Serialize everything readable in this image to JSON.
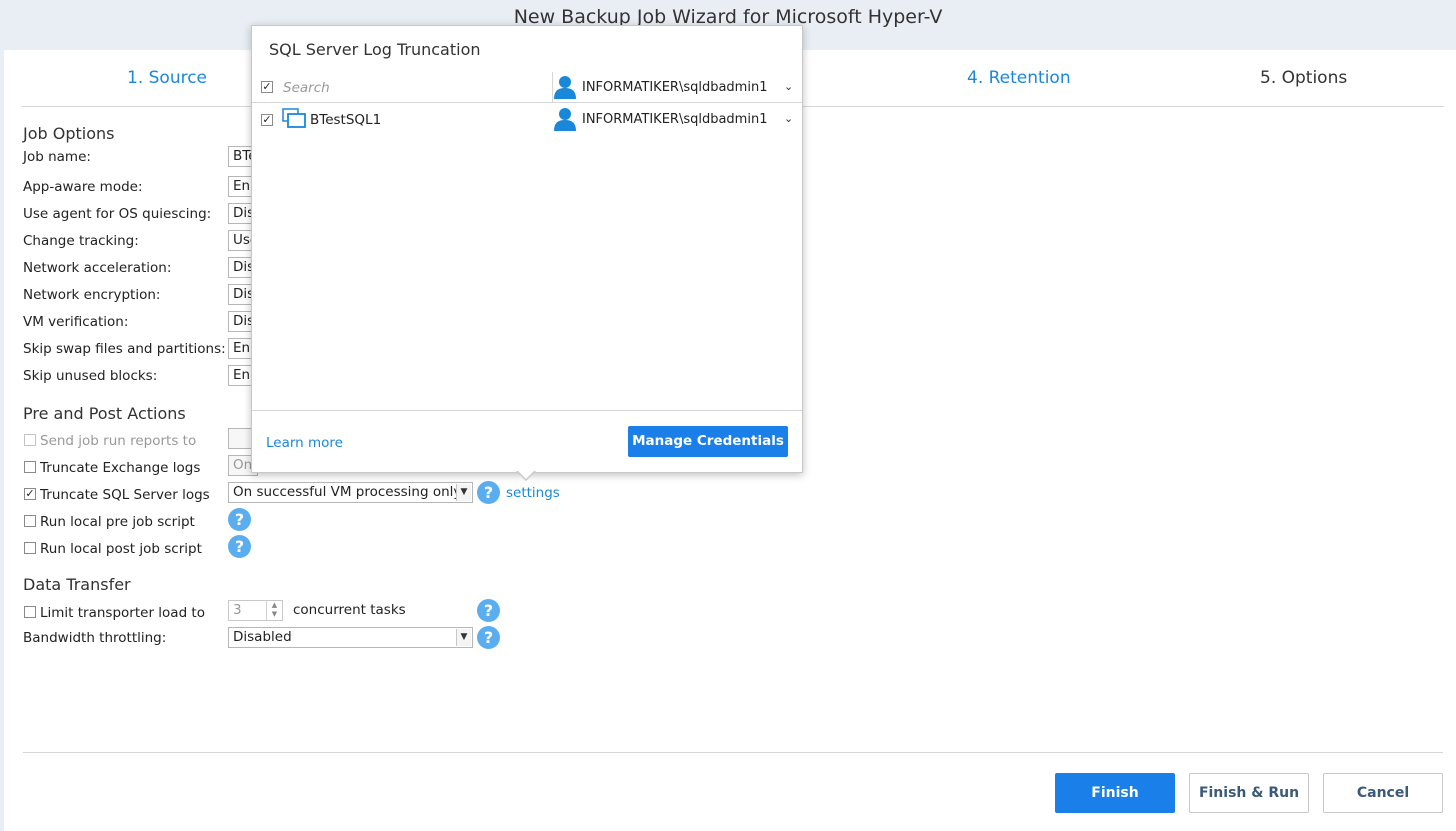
{
  "window": {
    "title": "New Backup Job Wizard for Microsoft Hyper-V"
  },
  "steps": [
    {
      "label": "1. Source",
      "state": "link"
    },
    {
      "label": "4. Retention",
      "state": "link"
    },
    {
      "label": "5. Options",
      "state": "active"
    }
  ],
  "job_options": {
    "title": "Job Options",
    "rows": [
      {
        "label": "Job name:",
        "value": "BTe"
      },
      {
        "label": "App-aware mode:",
        "value": "Ena"
      },
      {
        "label": "Use agent for OS quiescing:",
        "value": "Disa"
      },
      {
        "label": "Change tracking:",
        "value": "Use"
      },
      {
        "label": "Network acceleration:",
        "value": "Disa"
      },
      {
        "label": "Network encryption:",
        "value": "Disa"
      },
      {
        "label": "VM verification:",
        "value": "Disa"
      },
      {
        "label": "Skip swap files and partitions:",
        "value": "Ena"
      },
      {
        "label": "Skip unused blocks:",
        "value": "Ena"
      }
    ]
  },
  "pre_post": {
    "title": "Pre and Post Actions",
    "send_reports_label": "Send job run reports to",
    "truncate_exchange_label": "Truncate Exchange logs",
    "truncate_exchange_value": "On",
    "truncate_sql_label": "Truncate SQL Server logs",
    "truncate_sql_value": "On successful VM processing only",
    "settings_link": "settings",
    "pre_script_label": "Run local pre job script",
    "post_script_label": "Run local post job script"
  },
  "data_transfer": {
    "title": "Data Transfer",
    "limit_label": "Limit transporter load to",
    "limit_value": "3",
    "concurrent_label": "concurrent tasks",
    "bandwidth_label": "Bandwidth throttling:",
    "bandwidth_value": "Disabled"
  },
  "popup": {
    "title": "SQL Server Log Truncation",
    "search_placeholder": "Search",
    "header_credential": "INFORMATIKER\\sqldbadmin1",
    "vm_name": "BTestSQL1",
    "vm_credential": "INFORMATIKER\\sqldbadmin1",
    "learn_more": "Learn more",
    "manage_credentials": "Manage Credentials"
  },
  "footer": {
    "finish": "Finish",
    "finish_run": "Finish & Run",
    "cancel": "Cancel"
  },
  "colors": {
    "accent": "#1a7fe8",
    "link": "#1a88d8",
    "help": "#5aaef0"
  }
}
